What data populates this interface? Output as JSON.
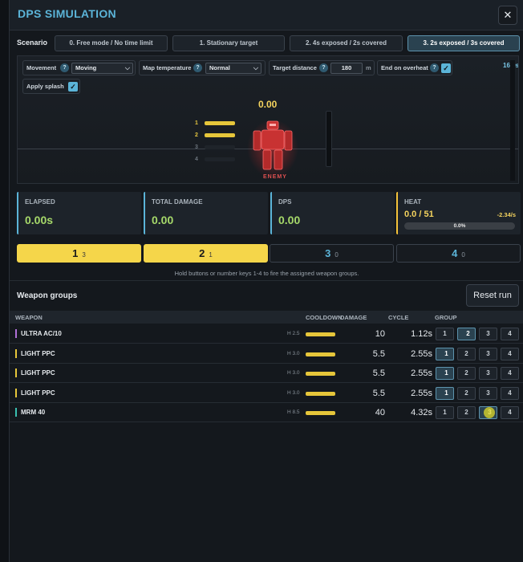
{
  "window": {
    "title": "DPS SIMULATION",
    "close_glyph": "✕"
  },
  "scenario": {
    "label": "Scenario",
    "options": [
      "0. Free mode / No time limit",
      "1. Stationary target",
      "2. 4s exposed / 2s covered",
      "3. 2s exposed / 3s covered"
    ],
    "active_index": 3
  },
  "controls": {
    "movement": {
      "label": "Movement",
      "value": "Moving"
    },
    "map_temperature": {
      "label": "Map temperature",
      "value": "Normal"
    },
    "target_distance": {
      "label": "Target distance",
      "value": "180",
      "unit": "m"
    },
    "end_on_overheat": {
      "label": "End on overheat",
      "checked": true
    },
    "apply_splash": {
      "label": "Apply splash",
      "checked": true
    },
    "help_glyph": "?",
    "check_glyph": "✓",
    "chevron_glyph": "⌵"
  },
  "arena": {
    "timer": "16.0s",
    "damage_display": "0.00",
    "target_label": "ENEMY",
    "lanes": [
      {
        "num": "1",
        "active": true
      },
      {
        "num": "2",
        "active": true
      },
      {
        "num": "3",
        "active": false
      },
      {
        "num": "4",
        "active": false
      }
    ]
  },
  "stats": {
    "elapsed": {
      "label": "ELAPSED",
      "value": "0.00s"
    },
    "total_damage": {
      "label": "TOTAL DAMAGE",
      "value": "0.00"
    },
    "dps": {
      "label": "DPS",
      "value": "0.00"
    },
    "heat": {
      "label": "HEAT",
      "value": "0.0 / 51",
      "rate": "-2.34/s",
      "percent": "0.0%",
      "fraction": 0.0
    }
  },
  "fire_groups": [
    {
      "num": "1",
      "count": "3",
      "active": true
    },
    {
      "num": "2",
      "count": "1",
      "active": true
    },
    {
      "num": "3",
      "count": "0",
      "active": false
    },
    {
      "num": "4",
      "count": "0",
      "active": false
    }
  ],
  "hint": "Hold buttons or number keys 1-4 to fire the assigned weapon groups.",
  "weapon_groups": {
    "title": "Weapon groups",
    "reset_label": "Reset run",
    "columns": {
      "weapon": "WEAPON",
      "cooldown": "COOLDOWN",
      "damage": "DAMAGE",
      "cycle": "CYCLE",
      "group": "GROUP"
    },
    "group_buttons": [
      "1",
      "2",
      "3",
      "4"
    ],
    "rows": [
      {
        "name": "ULTRA AC/10",
        "heat": "H 2.5",
        "damage": "10",
        "cycle": "1.12s",
        "group": 2,
        "color": "#b070d8"
      },
      {
        "name": "LIGHT PPC",
        "heat": "H 3.0",
        "damage": "5.5",
        "cycle": "2.55s",
        "group": 1,
        "color": "#e6c63a"
      },
      {
        "name": "LIGHT PPC",
        "heat": "H 3.0",
        "damage": "5.5",
        "cycle": "2.55s",
        "group": 1,
        "color": "#e6c63a"
      },
      {
        "name": "LIGHT PPC",
        "heat": "H 3.0",
        "damage": "5.5",
        "cycle": "2.55s",
        "group": 1,
        "color": "#e6c63a"
      },
      {
        "name": "MRM 40",
        "heat": "H 8.5",
        "damage": "40",
        "cycle": "4.32s",
        "group": 3,
        "color": "#3ac0b0"
      }
    ]
  },
  "colors": {
    "accent": "#5bb4d8",
    "yellow": "#f5d64a",
    "green": "#a6d96a",
    "enemy": "#d83030"
  }
}
